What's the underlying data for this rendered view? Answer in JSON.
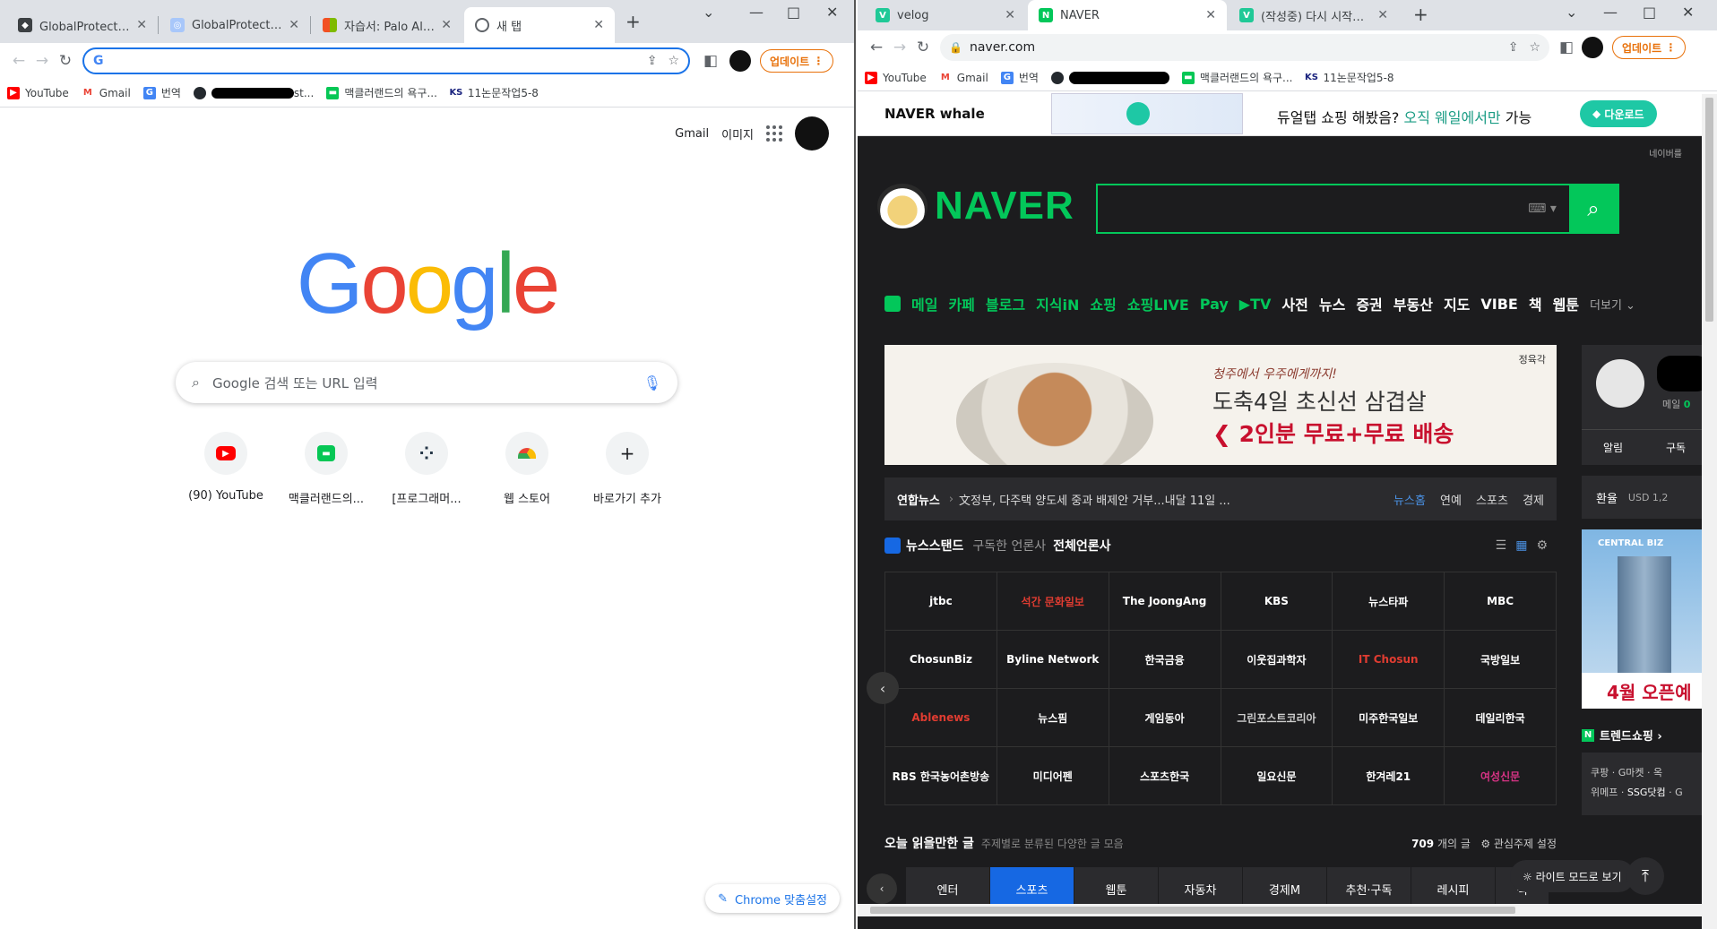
{
  "left": {
    "tabs": [
      {
        "title": "GlobalProtect 설정"
      },
      {
        "title": "GlobalProtect™ PC"
      },
      {
        "title": "자습서: Palo Alto N"
      },
      {
        "title": "새 탭"
      }
    ],
    "update_label": "업데이트",
    "bookmarks": [
      {
        "label": "YouTube"
      },
      {
        "label": "Gmail"
      },
      {
        "label": "번역"
      },
      {
        "label": "st..."
      },
      {
        "label": "맥클러랜드의 욕구..."
      },
      {
        "label": "11논문작업5-8"
      }
    ],
    "ntp": {
      "gmail": "Gmail",
      "images": "이미지",
      "logo": "Google",
      "search_placeholder": "Google 검색 또는 URL 입력",
      "shortcuts": [
        {
          "label": "(90) YouTube"
        },
        {
          "label": "맥클러랜드의..."
        },
        {
          "label": "[프로그래머..."
        },
        {
          "label": "웹 스토어"
        },
        {
          "label": "바로가기 추가"
        }
      ],
      "customize": "Chrome 맞춤설정"
    }
  },
  "right": {
    "tabs": [
      {
        "title": "velog"
      },
      {
        "title": "NAVER"
      },
      {
        "title": "(작성중) 다시 시작하는 윈도우"
      }
    ],
    "url": "naver.com",
    "update_label": "업데이트",
    "bookmarks": [
      {
        "label": "YouTube"
      },
      {
        "label": "Gmail"
      },
      {
        "label": "번역"
      },
      {
        "label": "맥클러랜드의 욕구..."
      },
      {
        "label": "11논문작업5-8"
      }
    ],
    "whale": {
      "brand": "NAVER whale",
      "text_pre": "듀얼탭 쇼핑 해봤음?",
      "text_accent": "오직 웨일에서만",
      "text_post": "가능",
      "download": "다운로드"
    },
    "naver": {
      "top_right": "네이버를",
      "logo": "NAVER",
      "services": [
        "메일",
        "카페",
        "블로그",
        "지식iN",
        "쇼핑",
        "쇼핑LIVE",
        "Pay",
        "▶TV",
        "사전",
        "뉴스",
        "증권",
        "부동산",
        "지도",
        "VIBE",
        "책",
        "웹툰"
      ],
      "services_more": "더보기 ⌄",
      "ad": {
        "brand": "정육각",
        "line1": "청주에서 우주에게까지!",
        "line2": "도축4일 초신선 삼겹살",
        "line3": "2인분 무료+무료 배송"
      },
      "news": {
        "source": "연합뉴스",
        "headline": "文정부, 다주택 양도세 중과 배제안 거부...내달 11일 ...",
        "cats": [
          "뉴스홈",
          "연예",
          "스포츠",
          "경제"
        ]
      },
      "stand": {
        "title": "뉴스스탠드",
        "sub": "구독한 언론사",
        "active": "전체언론사"
      },
      "press": [
        "jtbc",
        "석간 문화일보",
        "The JoongAng",
        "KBS",
        "뉴스타파",
        "MBC",
        "ChosunBiz",
        "Byline Network",
        "한국금융",
        "이웃집과학자",
        "IT Chosun",
        "국방일보",
        "Ablenews",
        "뉴스핌",
        "게임동아",
        "그린포스트코리아",
        "미주한국일보",
        "데일리한국",
        "RBS 한국농어촌방송",
        "미디어펜",
        "스포츠한국",
        "일요신문",
        "한겨레21",
        "여성신문"
      ],
      "reads": {
        "title": "오늘 읽을만한 글",
        "sub": "주제별로 분류된 다양한 글 모음",
        "count": "709",
        "count_unit": "개의 글",
        "settings": "⚙ 관심주제 설정"
      },
      "read_tabs": [
        "엔터",
        "스포츠",
        "웹툰",
        "자동차",
        "경제M",
        "추천·구독",
        "레시피",
        "책"
      ],
      "profile": {
        "mail_label": "메일",
        "mail_count": "0",
        "alarm": "알림",
        "subscribe": "구독"
      },
      "fx": {
        "label": "환율",
        "currency": "USD 1,2"
      },
      "side_ad": {
        "brand": "CENTRAL BIZ",
        "cta": "4월 오픈예"
      },
      "trend": {
        "title": "트렌드쇼핑 ›",
        "row1": [
          "쿠팡",
          "G마켓",
          "옥"
        ],
        "row2": [
          "위메프",
          "SSG닷컴",
          "G"
        ]
      },
      "lite_mode": "☼ 라이트 모드로 보기"
    }
  }
}
